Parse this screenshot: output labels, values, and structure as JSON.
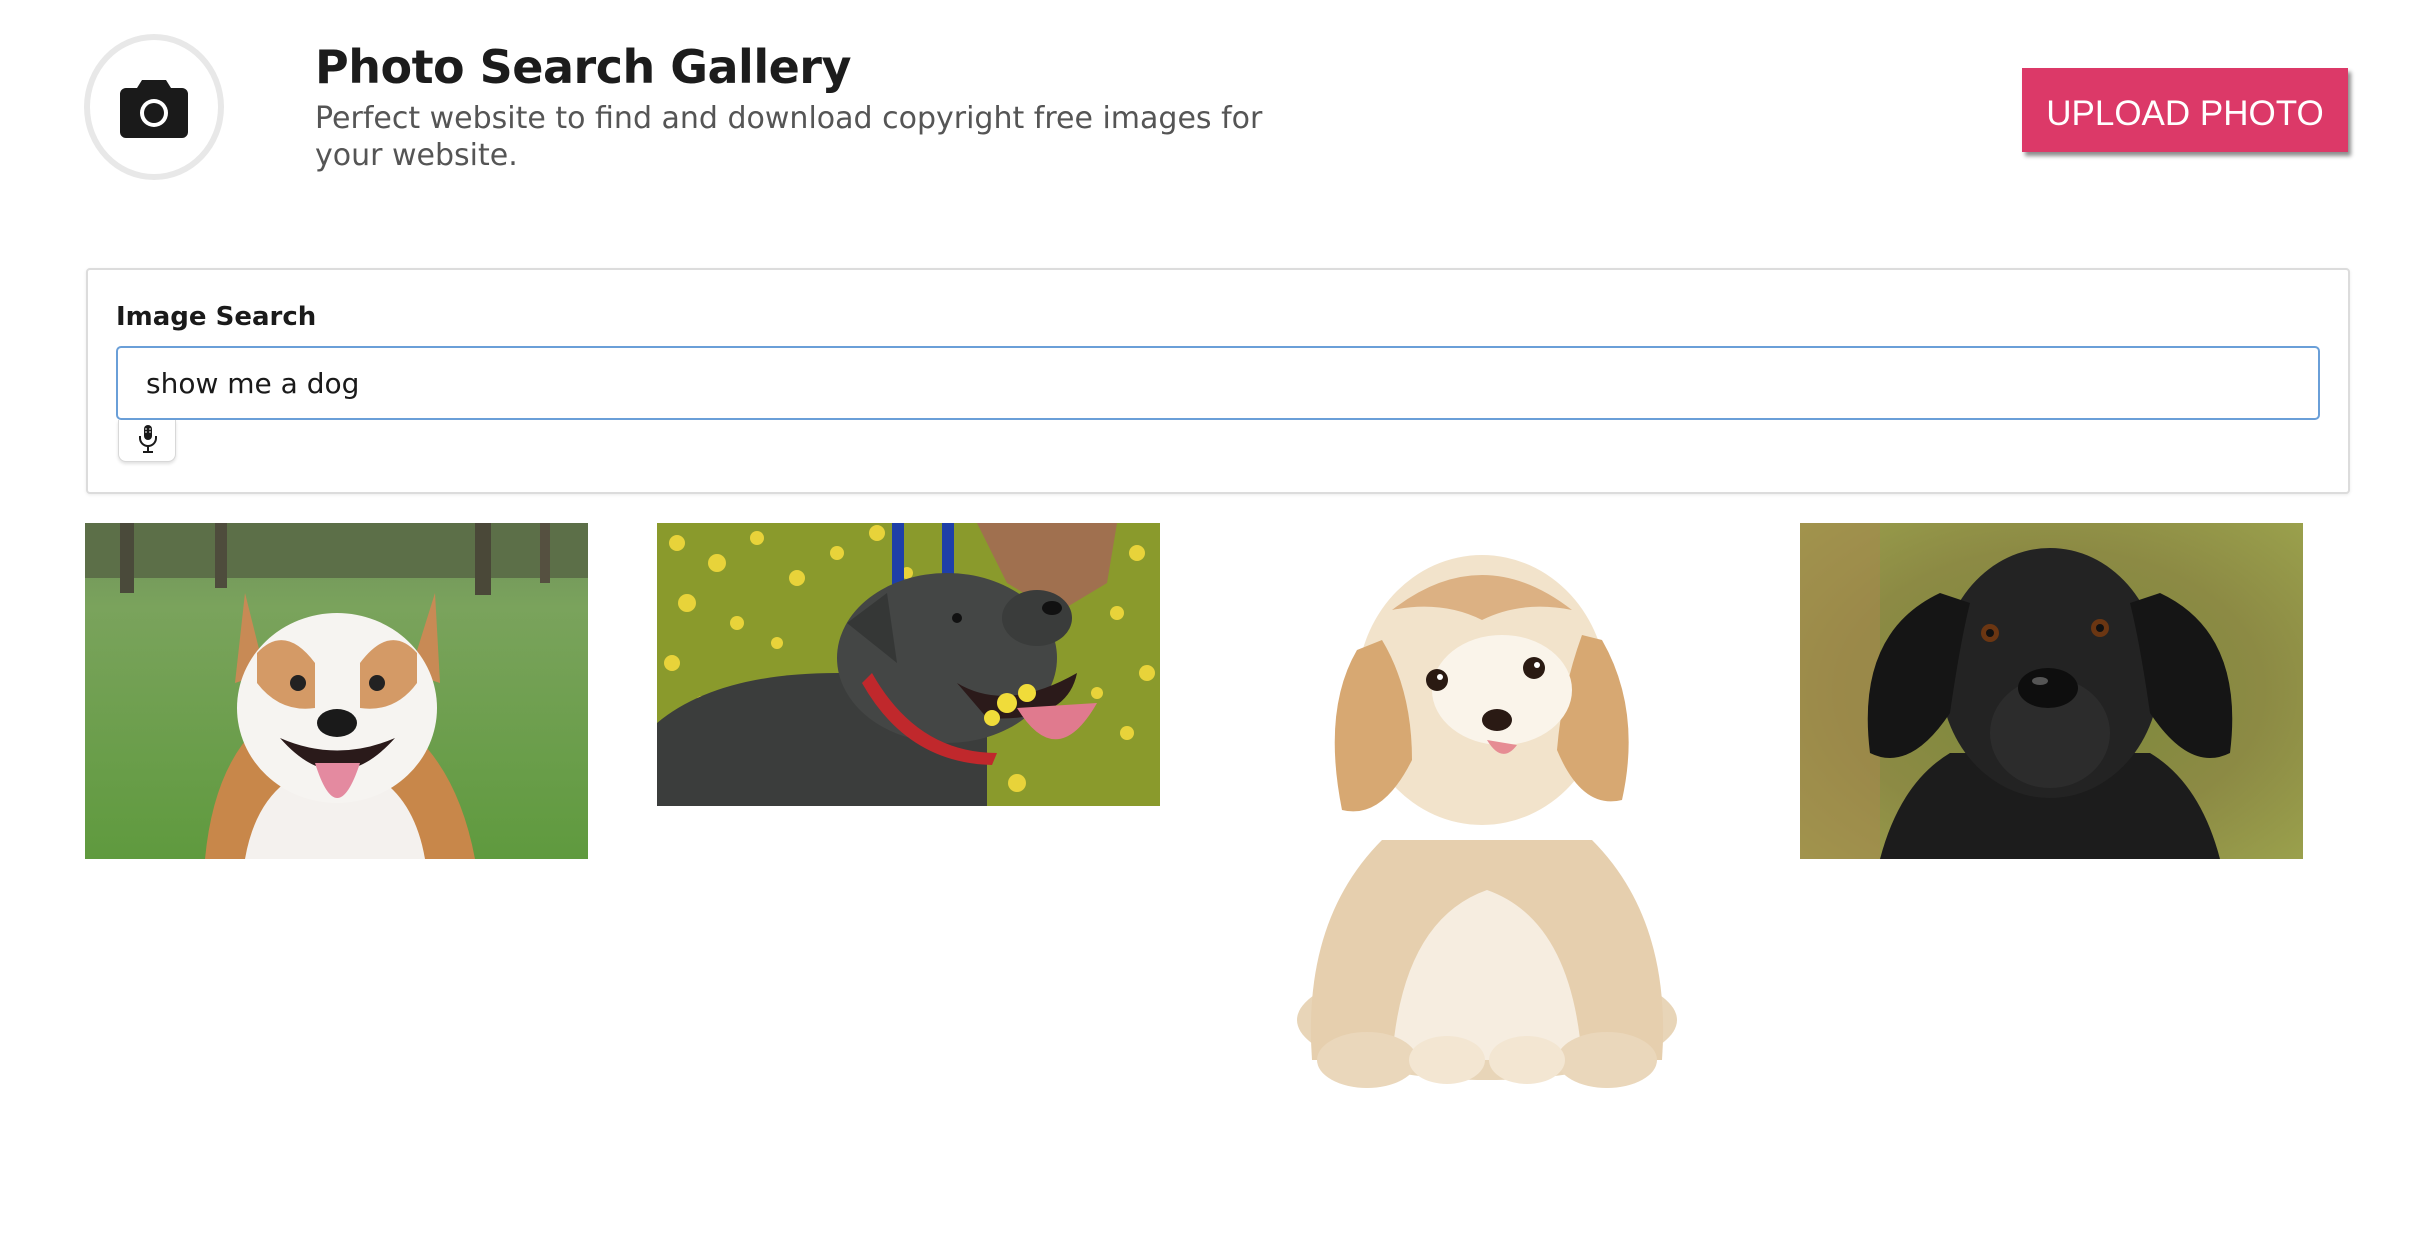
{
  "header": {
    "logo_icon": "camera-icon",
    "title": "Photo Search Gallery",
    "subtitle": "Perfect website to find and download copyright free images for your website.",
    "upload_label": "UPLOAD PHOTO",
    "upload_color": "#dc3968"
  },
  "search": {
    "label": "Image Search",
    "value": "show me a dog",
    "mic_icon": "microphone-icon",
    "focus_color": "#6a9fd8"
  },
  "gallery": {
    "images": [
      {
        "subject": "white and tan dog smiling on grass"
      },
      {
        "subject": "dark gray dog in yellow flowers with red collar"
      },
      {
        "subject": "fluffy cream puppy sitting on white background"
      },
      {
        "subject": "black labrador portrait on green background"
      }
    ]
  }
}
